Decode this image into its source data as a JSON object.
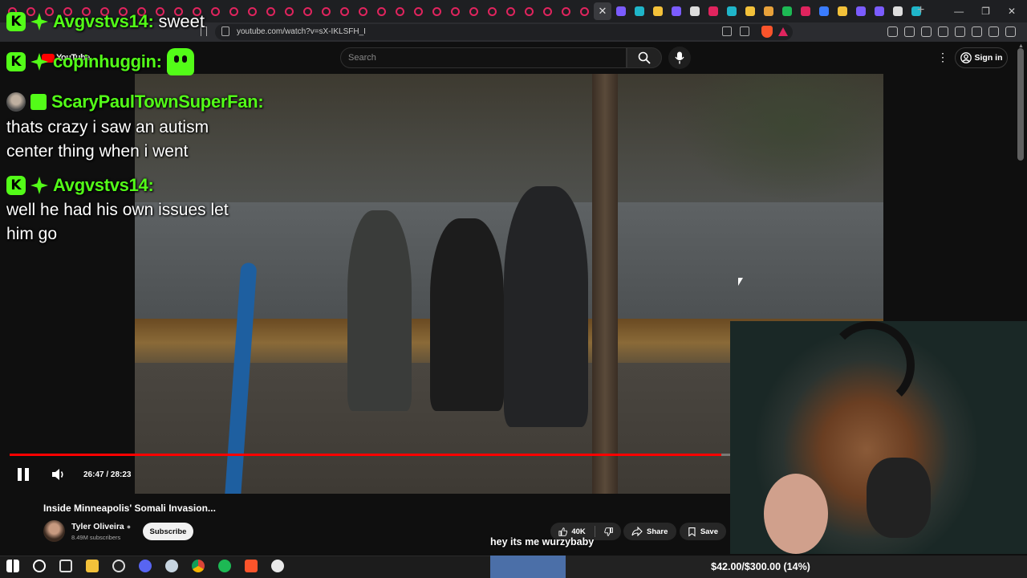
{
  "browser": {
    "url": "youtube.com/watch?v=sX-IKLSFH_I",
    "window_controls": [
      "—",
      "❐",
      "✕"
    ]
  },
  "youtube": {
    "logo_text": "YouTube",
    "search_placeholder": "Search",
    "signin_label": "Sign in",
    "player": {
      "time_display": "26:47 / 28:23",
      "progress_fraction": 0.9436,
      "state": "playing"
    },
    "video": {
      "title": "Inside Minneapolis' Somali Invasion...",
      "channel": "Tyler Oliveira",
      "subscribers": "8.49M subscribers",
      "subscribe_label": "Subscribe",
      "likes": "40K",
      "share_label": "Share",
      "save_label": "Save"
    }
  },
  "chat": [
    {
      "user": "Avgvstvs14:",
      "message": "sweet",
      "badges": [
        "kick-badge",
        "gem-badge"
      ]
    },
    {
      "user": "copinhuggin:",
      "message": "",
      "emote": "green-face-emote",
      "badges": [
        "kick-badge",
        "gem-badge"
      ]
    },
    {
      "user": "ScaryPaulTownSuperFan:",
      "message": "thats crazy i saw an autism center thing when i went",
      "badges": [
        "avatar",
        "gift-badge"
      ]
    },
    {
      "user": "Avgvstvs14:",
      "message": "well he had his own issues let him go",
      "badges": [
        "kick-badge",
        "gem-badge"
      ]
    }
  ],
  "stream": {
    "caption": "hey its me wurzybaby",
    "goal_text": "$42.00/$300.00 (14%)",
    "goal_fraction": 0.14
  },
  "colors": {
    "kick_green": "#53fc18",
    "yt_red": "#ff0000",
    "goal_blue": "#4b6fa8"
  }
}
